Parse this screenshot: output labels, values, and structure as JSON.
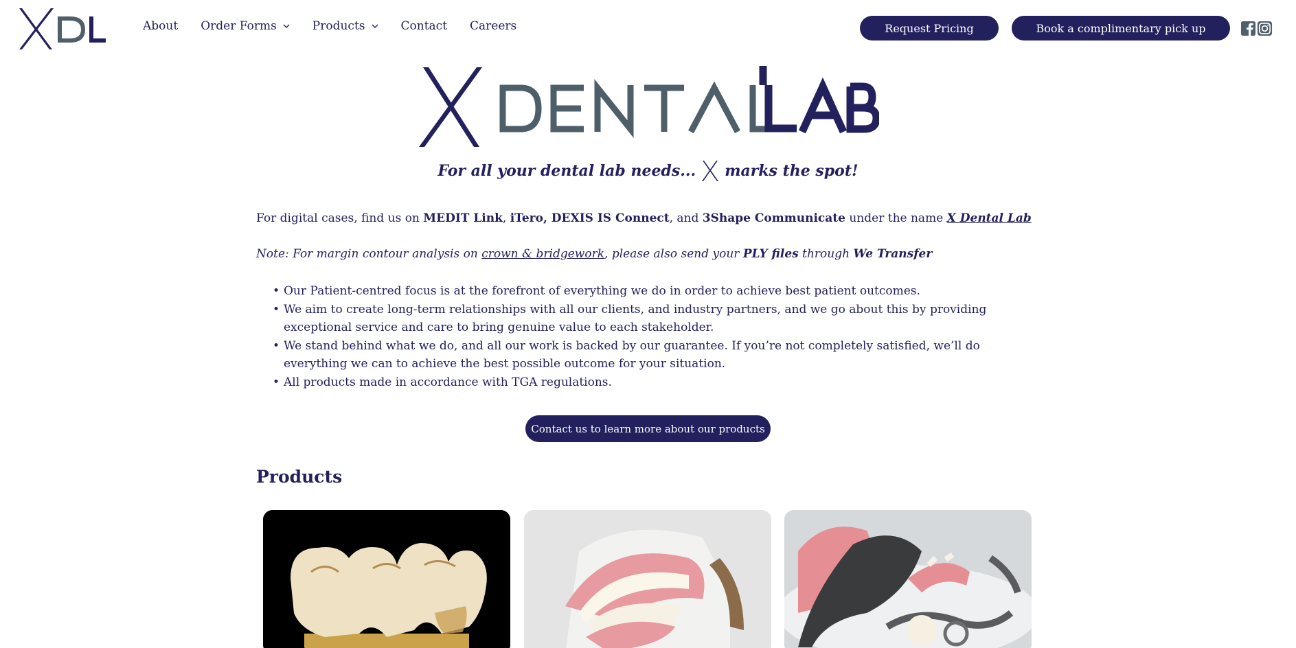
{
  "header": {
    "logo_icon": "xdl-logo",
    "nav": [
      {
        "label": "About",
        "dropdown": false
      },
      {
        "label": "Order Forms",
        "dropdown": true
      },
      {
        "label": "Products",
        "dropdown": true
      },
      {
        "label": "Contact",
        "dropdown": false
      },
      {
        "label": "Careers",
        "dropdown": false
      }
    ],
    "request_pricing_label": "Request Pricing",
    "pickup_label": "Book a complimentary pick up",
    "social_icons": [
      "facebook-icon",
      "instagram-icon"
    ]
  },
  "hero": {
    "logo_icon": "x-dental-lab-logo",
    "tagline_before": "For all your dental lab needs...",
    "tagline_after": "marks the spot!"
  },
  "intro": {
    "p1_a": "For digital cases, find us on ",
    "p1_medit": "MEDIT Link",
    "p1_comma1": ", ",
    "p1_itero": "iTero, DEXIS IS Connect",
    "p1_and": ", and ",
    "p1_3shape": "3Shape Communicate",
    "p1_under": " under the name ",
    "p1_name": "X Dental Lab",
    "p2_a": "Note: For margin contour analysis on ",
    "p2_link": "crown & bridgework",
    "p2_b": ", please also send your ",
    "p2_ply": "PLY files",
    "p2_through": " through ",
    "p2_wetransfer": "We Transfer"
  },
  "benefits": [
    "Our Patient-centred focus is at the forefront of everything we do in order to achieve best patient outcomes.",
    "We aim to create long-term relationships with all our clients, and industry partners, and we go about this by providing exceptional service and care to bring genuine value to each stakeholder.",
    "We stand behind what we do, and all our work is backed by our guarantee. If you’re not completely satisfied, we’ll do everything we can to achieve the best possible outcome for your situation.",
    "All products made in accordance with TGA  regulations."
  ],
  "cta_label": "Contact us to learn more about our products",
  "products_title": "Products",
  "colors": {
    "brand_navy": "#23205e",
    "brand_slate": "#4e5f6a",
    "white": "#ffffff"
  }
}
